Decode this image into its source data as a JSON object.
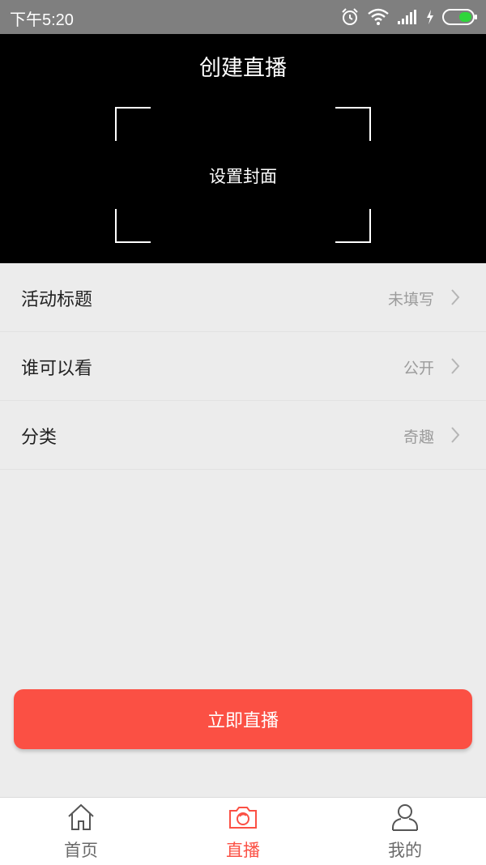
{
  "status_bar": {
    "time": "下午5:20"
  },
  "header": {
    "title": "创建直播",
    "cover_label": "设置封面"
  },
  "settings": [
    {
      "label": "活动标题",
      "value": "未填写"
    },
    {
      "label": "谁可以看",
      "value": "公开"
    },
    {
      "label": "分类",
      "value": "奇趣"
    }
  ],
  "primary_button": {
    "label": "立即直播",
    "color": "#fb5044"
  },
  "tabs": [
    {
      "label": "首页",
      "icon": "home-icon",
      "active": false
    },
    {
      "label": "直播",
      "icon": "camera-icon",
      "active": true
    },
    {
      "label": "我的",
      "icon": "user-icon",
      "active": false
    }
  ],
  "colors": {
    "accent": "#fb5044",
    "header_bg": "#000000",
    "status_bg": "#7f7f7f",
    "page_bg": "#ececec"
  }
}
